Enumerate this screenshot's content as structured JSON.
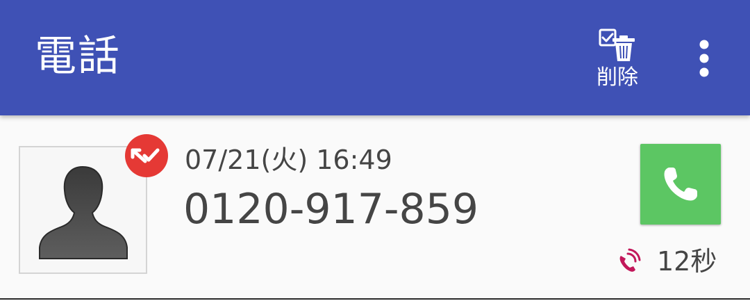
{
  "header": {
    "title": "電話",
    "delete_label": "削除",
    "menu_icon": "more-vert-icon",
    "delete_icon": "checkbox-trash-icon",
    "background_color": "#3f51b5"
  },
  "call_log": {
    "items": [
      {
        "date": "07/21(火) 16:49",
        "number": "0120-917-859",
        "duration": "12秒",
        "status_badge_icon": "missed-call-icon",
        "status_badge_color": "#e53935",
        "call_type_icon": "incoming-call-icon",
        "call_type_color": "#c2185b",
        "call_button_icon": "phone-icon",
        "call_button_color": "#5cc663",
        "avatar_icon": "default-contact-icon"
      }
    ]
  }
}
